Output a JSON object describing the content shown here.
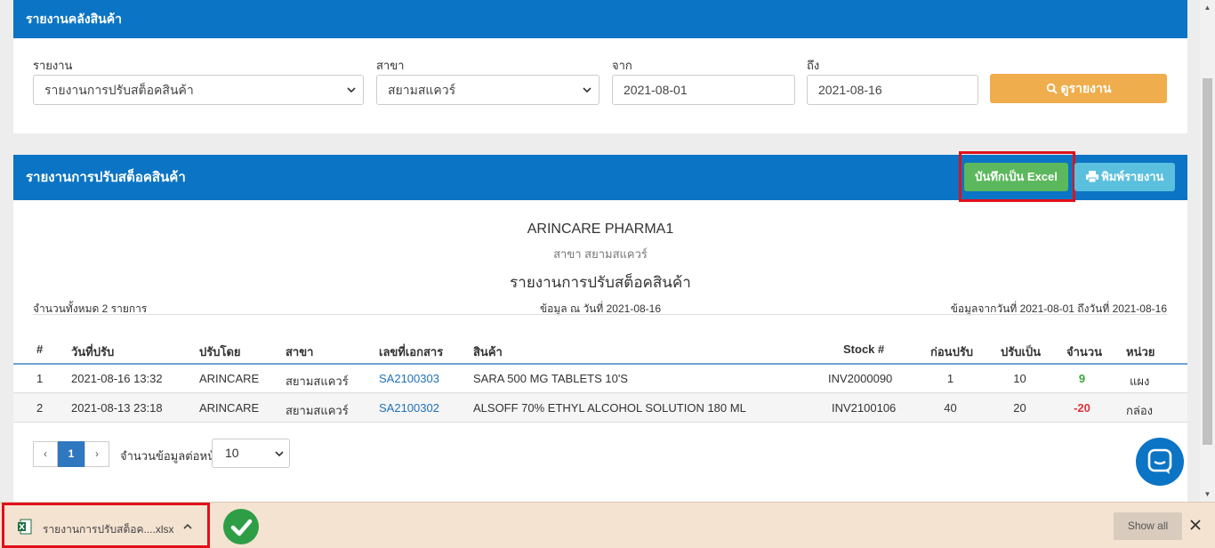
{
  "filter_panel": {
    "title": "รายงานคลังสินค้า",
    "report_label": "รายงาน",
    "report_value": "รายงานการปรับสต็อคสินค้า",
    "branch_label": "สาขา",
    "branch_value": "สยามสแควร์",
    "from_label": "จาก",
    "from_value": "2021-08-01",
    "to_label": "ถึง",
    "to_value": "2021-08-16",
    "view_button": "ดูรายงาน"
  },
  "report_panel": {
    "title": "รายงานการปรับสต็อคสินค้า",
    "excel_button": "บันทึกเป็น Excel",
    "print_button": "พิมพ์รายงาน",
    "company": "ARINCARE PHARMA1",
    "branch_line": "สาขา สยามสแควร์",
    "report_title": "รายงานการปรับสต็อคสินค้า",
    "total_text": "จำนวนทั้งหมด 2 รายการ",
    "data_as_of": "ข้อมูล ณ วันที่ 2021-08-16",
    "date_range": "ข้อมูลจากวันที่ 2021-08-01 ถึงวันที่ 2021-08-16"
  },
  "table": {
    "headers": [
      "#",
      "วันที่ปรับ",
      "ปรับโดย",
      "สาขา",
      "เลขที่เอกสาร",
      "สินค้า",
      "Stock #",
      "ก่อนปรับ",
      "ปรับเป็น",
      "จำนวน",
      "หน่วย"
    ],
    "rows": [
      {
        "no": "1",
        "date": "2021-08-16 13:32",
        "by": "ARINCARE",
        "branch": "สยามสแควร์",
        "doc": "SA2100303",
        "product": "SARA 500 MG TABLETS 10'S",
        "stock": "INV2000090",
        "before": "1",
        "after": "10",
        "qty": "9",
        "unit": "แผง"
      },
      {
        "no": "2",
        "date": "2021-08-13 23:18",
        "by": "ARINCARE",
        "branch": "สยามสแควร์",
        "doc": "SA2100302",
        "product": "ALSOFF 70% ETHYL ALCOHOL SOLUTION 180 ML",
        "stock": "INV2100106",
        "before": "40",
        "after": "20",
        "qty": "-20",
        "unit": "กล่อง"
      }
    ]
  },
  "pagination": {
    "prev": "‹",
    "current": "1",
    "next": "›",
    "per_page_label": "จำนวนข้อมูลต่อหน้า",
    "per_page_value": "10"
  },
  "download_bar": {
    "file_name": "รายงานการปรับสต็อค....xlsx",
    "show_all": "Show all"
  },
  "colors": {
    "header_blue": "#0b74c4",
    "excel_green": "#5cb85c",
    "view_orange": "#efad4d",
    "print_cyan": "#5bc0de",
    "highlight_red": "#e0101a"
  }
}
